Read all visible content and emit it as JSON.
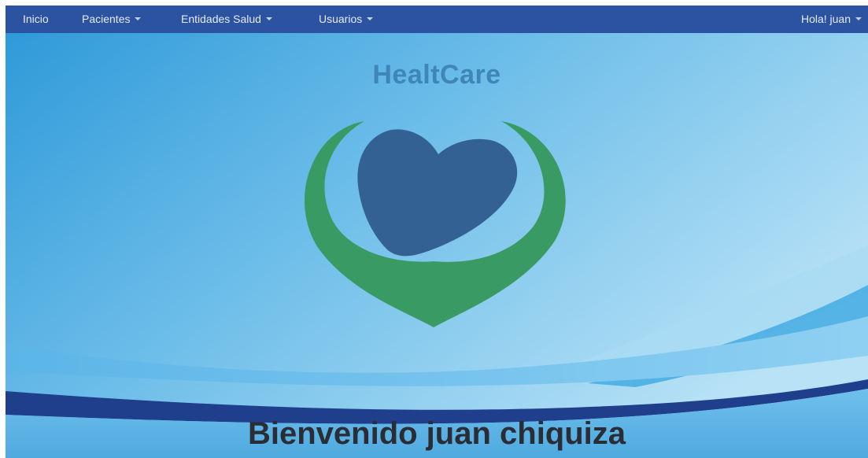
{
  "navbar": {
    "items": [
      {
        "label": "Inicio",
        "dropdown": false
      },
      {
        "label": "Pacientes",
        "dropdown": true
      },
      {
        "label": "Entidades Salud",
        "dropdown": true
      },
      {
        "label": "Usuarios",
        "dropdown": true
      }
    ],
    "user_menu": {
      "label": "Hola! juan",
      "dropdown": true
    },
    "background_color": "#2c52a2"
  },
  "hero": {
    "brand_title": "HealtCare",
    "logo_icon": "heart-hands-icon",
    "logo_colors": {
      "hands": "#3a9a64",
      "heart": "#336193"
    },
    "welcome_text": "Bienvenido juan chiquiza",
    "background_colors": {
      "light": "#9fd6f2",
      "mid": "#3a9fdc",
      "dark_band": "#1f3f8c"
    }
  }
}
